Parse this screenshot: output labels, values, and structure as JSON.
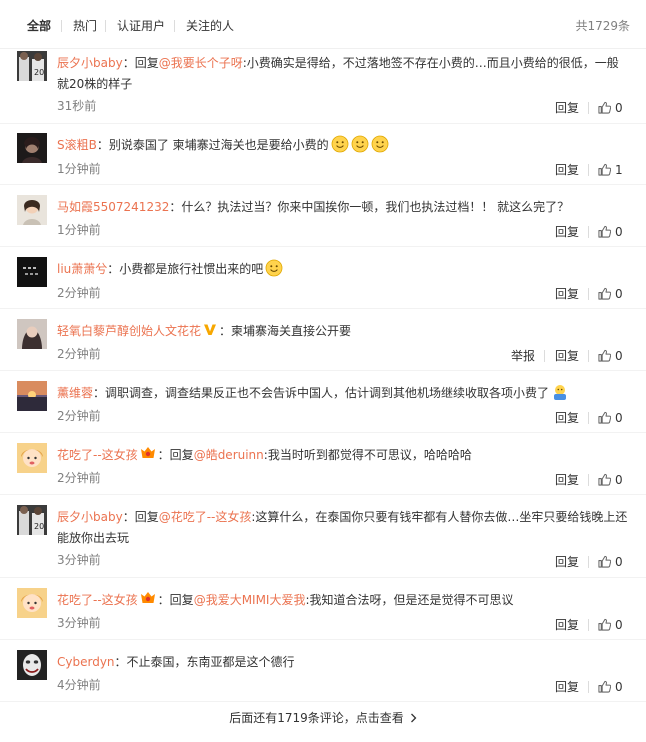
{
  "filter": {
    "tabs": [
      {
        "label": "全部",
        "active": true
      },
      {
        "label": "热门",
        "active": false
      },
      {
        "label": "认证用户",
        "active": false
      },
      {
        "label": "关注的人",
        "active": false
      }
    ],
    "total": "共1729条"
  },
  "colors": {
    "accent": "#eb7350",
    "muted": "#808080",
    "text": "#333333"
  },
  "comments": [
    {
      "username": "辰夕小baby",
      "prefix": "回复",
      "mention": "@我要长个子呀",
      "text": ":小费确实是得给，不过落地签不存在小费的…而且小费给的很低，一般就20株的样子",
      "time": "31秒前",
      "reply": "回复",
      "likes": "0",
      "avatar_icon": "player-photo-avatar"
    },
    {
      "username": "S滚粗B",
      "prefix": "",
      "mention": "",
      "text": "：别说泰国了 柬埔寨过海关也是要给小费的",
      "emoji": [
        "smile-emoji",
        "smile-emoji",
        "smile-emoji"
      ],
      "time": "1分钟前",
      "reply": "回复",
      "likes": "1",
      "avatar_icon": "dark-portrait-avatar"
    },
    {
      "username": "马如霞5507241232",
      "prefix": "",
      "mention": "",
      "text": "：什么？执法过当？你来中国挨你一顿，我们也执法过档！！ 就这么完了？",
      "time": "1分钟前",
      "reply": "回复",
      "likes": "0",
      "avatar_icon": "girl-photo-avatar"
    },
    {
      "username": "liu萧萧兮",
      "prefix": "",
      "mention": "",
      "text": "：小费都是旅行社惯出来的吧",
      "emoji": [
        "smile-emoji"
      ],
      "time": "2分钟前",
      "reply": "回复",
      "likes": "0",
      "avatar_icon": "black-text-avatar"
    },
    {
      "username": "轻氧白藜芦醇创始人文花花",
      "verified": true,
      "prefix": "",
      "mention": "",
      "text": "：柬埔寨海关直接公开要",
      "time": "2分钟前",
      "report": "举报",
      "reply": "回复",
      "likes": "0",
      "avatar_icon": "portrait-avatar"
    },
    {
      "username": "薰维蓉",
      "prefix": "",
      "mention": "",
      "text": "：调职调查，调查结果反正也不会告诉中国人，估计调到其他机场继续收取各项小费了",
      "emoji": [
        "shrug-emoji"
      ],
      "time": "2分钟前",
      "reply": "回复",
      "likes": "0",
      "avatar_icon": "sunset-avatar"
    },
    {
      "username": "花吃了--这女孩",
      "badge": true,
      "prefix": "：回复",
      "mention": "@皓deruinn",
      "text": ":我当时听到都觉得不可思议，哈哈哈哈",
      "time": "2分钟前",
      "reply": "回复",
      "likes": "0",
      "avatar_icon": "cartoon-girl-avatar"
    },
    {
      "username": "辰夕小baby",
      "prefix": "：回复",
      "mention": "@花吃了--这女孩",
      "text": ":这算什么，在泰国你只要有钱牢都有人替你去做…坐牢只要给钱晚上还能放你出去玩",
      "time": "3分钟前",
      "reply": "回复",
      "likes": "0",
      "avatar_icon": "player-photo-avatar"
    },
    {
      "username": "花吃了--这女孩",
      "badge": true,
      "prefix": "：回复",
      "mention": "@我爱大MIMI大爱我",
      "text": ":我知道合法呀，但是还是觉得不可思议",
      "time": "3分钟前",
      "reply": "回复",
      "likes": "0",
      "avatar_icon": "cartoon-girl-avatar"
    },
    {
      "username": "Cyberdyn",
      "prefix": "",
      "mention": "",
      "text": "：不止泰国，东南亚都是这个德行",
      "time": "4分钟前",
      "reply": "回复",
      "likes": "0",
      "avatar_icon": "joker-face-avatar"
    }
  ],
  "more_link": "后面还有1719条评论，点击查看"
}
